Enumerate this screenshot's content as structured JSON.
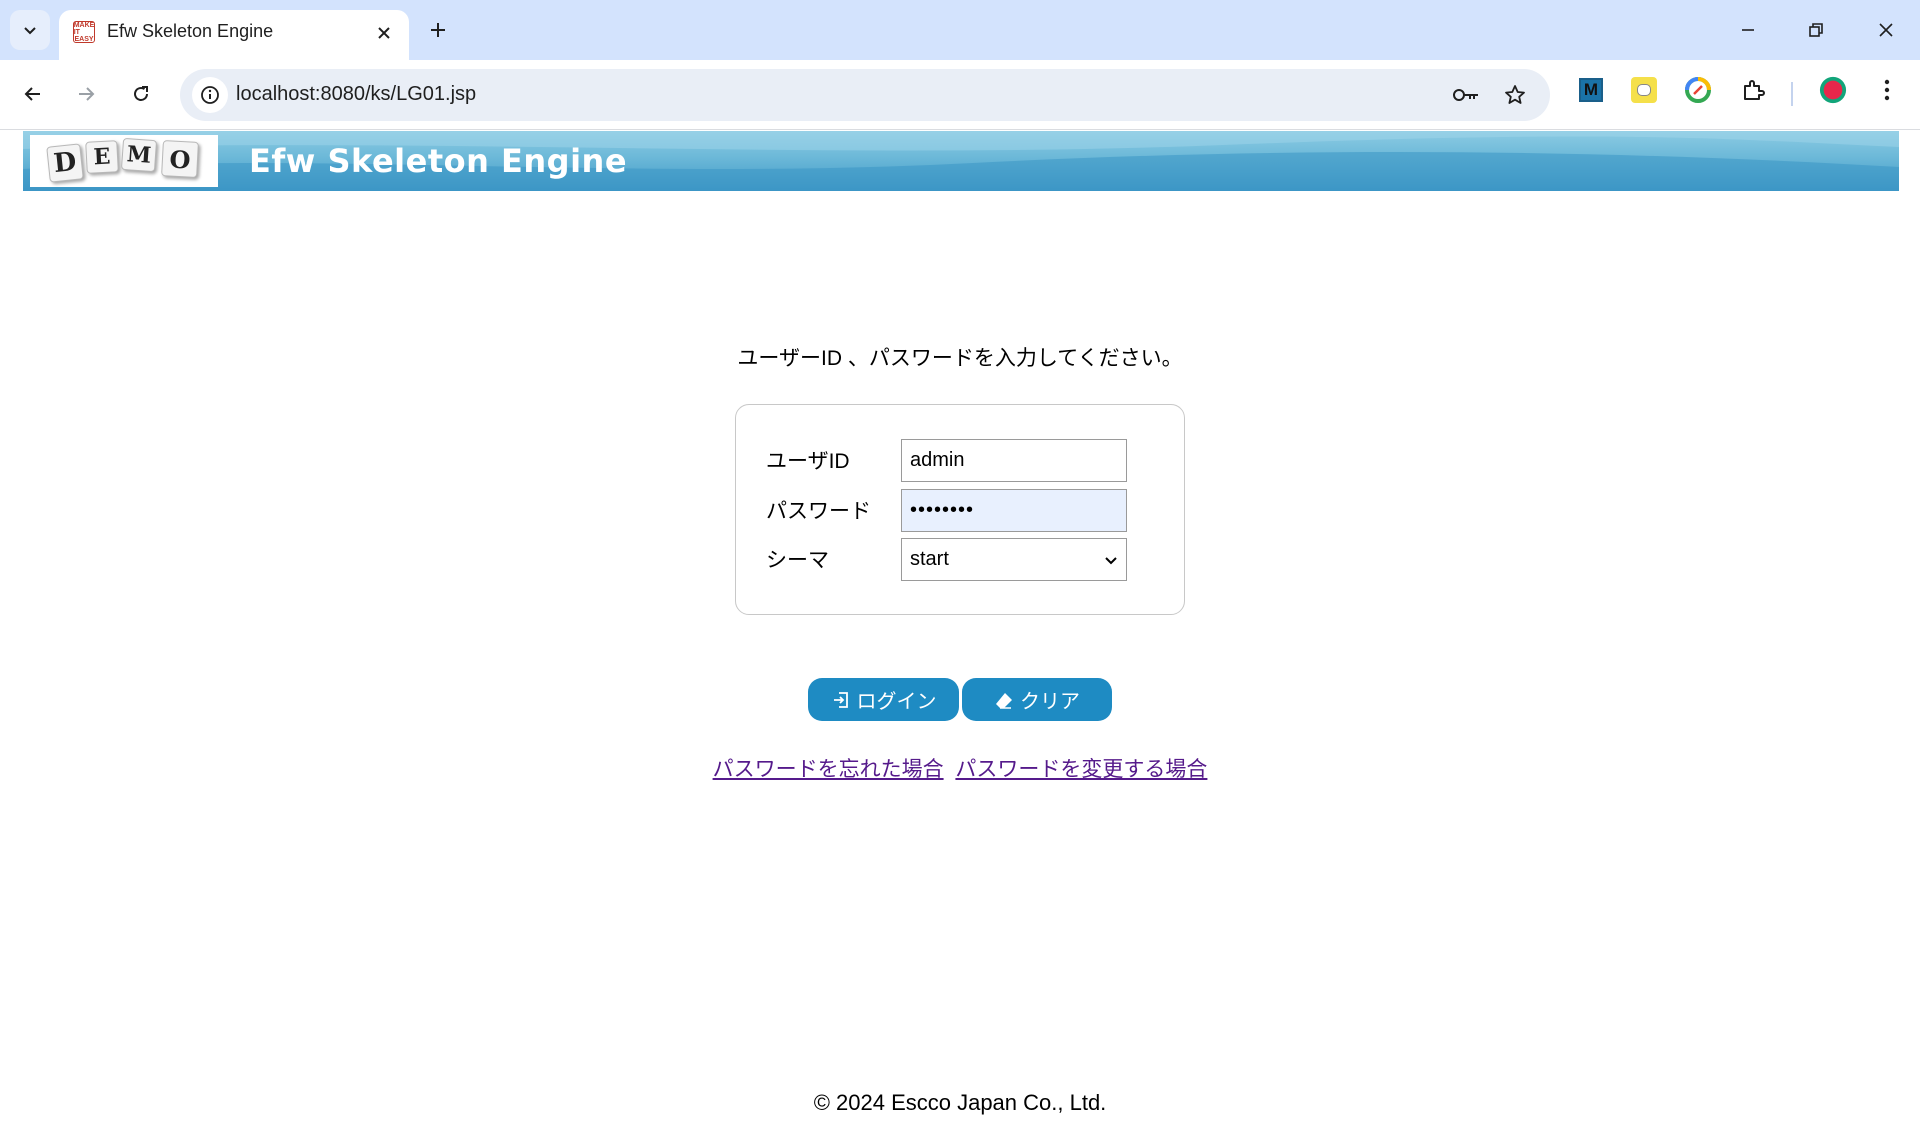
{
  "browser": {
    "tab_title": "Efw Skeleton Engine",
    "favicon_text_top": "MAKE IT",
    "favicon_text_bottom": "EASY",
    "url": "localhost:8080/ks/LG01.jsp",
    "icons": {
      "tab_search": "chevron-down-icon",
      "tab_close": "close-icon",
      "new_tab": "plus-icon",
      "minimize": "minimize-icon",
      "restore": "restore-icon",
      "close_window": "close-icon",
      "back": "arrow-left-icon",
      "forward": "arrow-right-icon",
      "reload": "reload-icon",
      "site_info": "info-icon",
      "password_key": "key-icon",
      "bookmark": "star-icon",
      "extensions": [
        "m-extension-icon",
        "dog-extension-icon",
        "color-extension-icon",
        "puzzle-icon"
      ],
      "profile": "profile-avatar-icon",
      "menu": "kebab-menu-icon"
    },
    "extension_m_label": "M"
  },
  "header": {
    "logo_letters": [
      "D",
      "E",
      "M",
      "O"
    ],
    "title": "Efw Skeleton Engine"
  },
  "login": {
    "instruction": "ユーザーID 、パスワードを入力してください。",
    "userid_label": "ユーザID",
    "userid_value": "admin",
    "password_label": "パスワード",
    "password_value": "••••••••",
    "schema_label": "シーマ",
    "schema_value": "start",
    "login_button": "ログイン",
    "clear_button": "クリア",
    "forgot_link": "パスワードを忘れた場合",
    "change_link": "パスワードを変更する場合"
  },
  "footer": {
    "copyright": "© 2024 Escco Japan Co., Ltd."
  },
  "colors": {
    "tabstrip": "#d3e3fd",
    "header_gradient_top": "#8ccbe3",
    "header_gradient_bottom": "#3f98c7",
    "button": "#1e8bc3",
    "link": "#551a8b",
    "password_autofill": "#e8f0fe"
  }
}
